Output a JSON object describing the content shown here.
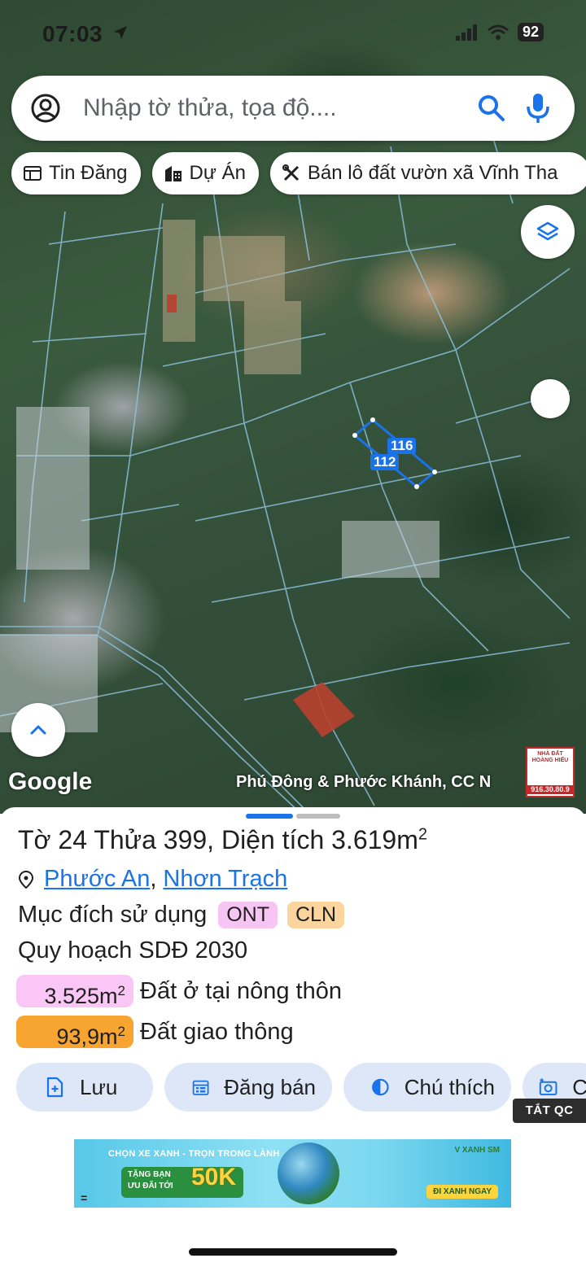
{
  "status_bar": {
    "time": "07:03",
    "battery": "92"
  },
  "search": {
    "placeholder": "Nhập tờ thửa, tọa độ...."
  },
  "chips": [
    {
      "label": "Tin Đăng",
      "icon": "newspaper-icon"
    },
    {
      "label": "Dự Án",
      "icon": "building-icon"
    },
    {
      "label": "Bán lô đất vườn xã Vĩnh Tha",
      "icon": "tools-icon"
    }
  ],
  "map": {
    "parcel_labels": [
      "116",
      "112"
    ],
    "google_logo": "Google",
    "credit": "Phú Đông & Phước Khánh, CC N",
    "billboard": {
      "title": "NHÀ ĐẤT HOÀNG HIẾU",
      "phone": "916.30.80.9"
    }
  },
  "parcel": {
    "sheet_label": "Tờ",
    "sheet_no": "24",
    "plot_label": "Thửa",
    "plot_no": "399",
    "area_label": ", Diện tích",
    "area_value": "3.619m",
    "area_unit_sup": "2",
    "ward": "Phước An",
    "district": "Nhơn Trạch",
    "purpose_label": "Mục đích sử dụng",
    "purpose_tags": [
      "ONT",
      "CLN"
    ],
    "plan_label": "Quy hoạch SDĐ 2030",
    "zones": [
      {
        "area": "3.525m",
        "sup": "2",
        "label": "Đất ở tại nông thôn",
        "color": "#f9c6f5"
      },
      {
        "area": "93,9m",
        "sup": "2",
        "label": "Đất giao thông",
        "color": "#f8a431"
      }
    ]
  },
  "actions": {
    "save": "Lưu",
    "post": "Đăng bán",
    "legend": "Chú thích",
    "camera": "C"
  },
  "ad": {
    "close_label": "TẮT QC",
    "headline": "CHỌN XE XANH - TRỌN TRONG LÀNH",
    "gift_line1": "TẶNG BẠN",
    "gift_line2": "ƯU ĐÃI TỚI",
    "amount": "50K",
    "brand": "V XANH SM",
    "cta": "ĐI XANH NGAY",
    "menu": "="
  },
  "colors": {
    "accent": "#1a73e8",
    "action_bg": "#dde7f7",
    "parcel_outline": "#1a73e8"
  }
}
